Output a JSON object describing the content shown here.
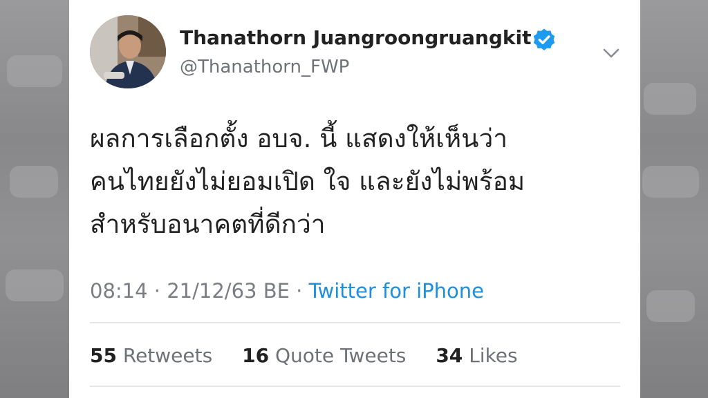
{
  "profile": {
    "name": "Thanathorn Juangroongruangkit",
    "handle": "@Thanathorn_FWP"
  },
  "tweet": {
    "lines": [
      "ผลการเลือกตั้ง อบจ. นี้ แสดงให้เห็นว่า",
      "คนไทยยังไม่ยอมเปิด ใจ และยังไม่พร้อม",
      "สำหรับอนาคตที่ดีกว่า"
    ],
    "timestamp": "08:14 · 21/12/63 BE · ",
    "source": "Twitter for iPhone"
  },
  "stats": {
    "retweets_count": "55",
    "retweets_label": "Retweets",
    "quotes_count": "16",
    "quotes_label": "Quote Tweets",
    "likes_count": "34",
    "likes_label": "Likes"
  },
  "icons": {
    "verified": "verified-badge-icon",
    "menu": "chevron-down-icon"
  },
  "colors": {
    "verified_blue": "#1d9bf0",
    "link_blue": "#1d8fdd",
    "text_dark": "#222222",
    "text_muted": "#6e7277"
  }
}
